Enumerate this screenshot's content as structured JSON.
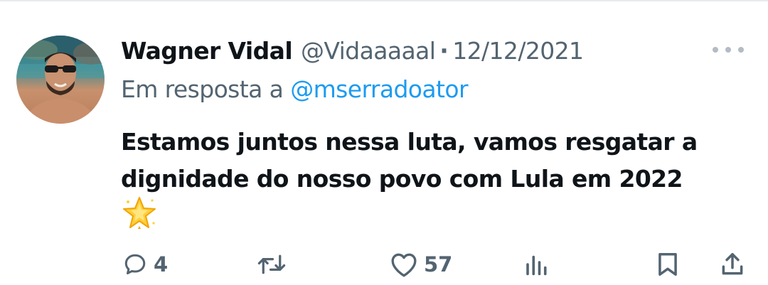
{
  "tweet": {
    "display_name": "Wagner Vidal",
    "handle": "@Vidaaaaal",
    "separator": "·",
    "date": "12/12/2021",
    "reply_label": "Em resposta a",
    "reply_mention": "@mserradoator",
    "text": "Estamos juntos nessa luta, vamos resgatar a dignidade do nosso povo com Lula em 2022",
    "emoji": "glowing-star-icon"
  },
  "actions": {
    "reply_count": "4",
    "retweet_count": "",
    "like_count": "57",
    "views_count": ""
  },
  "colors": {
    "text_primary": "#0f1419",
    "text_secondary": "#536471",
    "accent_blue": "#1d9bf0",
    "icon_gray": "#536471"
  }
}
